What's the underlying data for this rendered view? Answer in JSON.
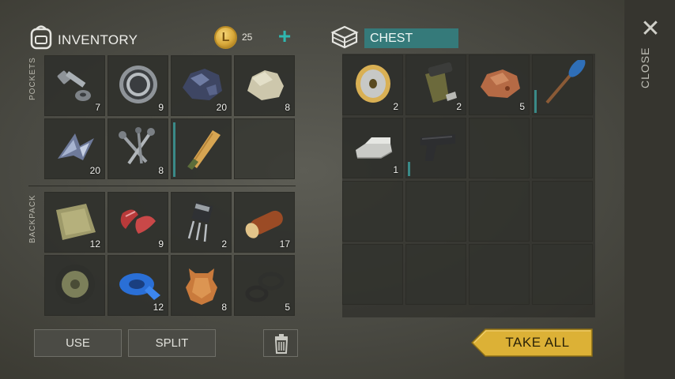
{
  "inventory": {
    "title": "INVENTORY",
    "coins": "25"
  },
  "chest": {
    "title": "CHEST"
  },
  "close": {
    "label": "CLOSE"
  },
  "sections": {
    "pockets": "POCKETS",
    "backpack": "BACKPACK"
  },
  "pockets": [
    {
      "name": "bolt-nut-item",
      "icon": "bolt-and-nut",
      "count": "7"
    },
    {
      "name": "bearing-item",
      "icon": "ball-bearing",
      "count": "9"
    },
    {
      "name": "ore-item",
      "icon": "iron-ore",
      "count": "20"
    },
    {
      "name": "stone-item",
      "icon": "stone",
      "count": "8"
    },
    {
      "name": "scrap-metal-item",
      "icon": "scrap-metal",
      "count": "20"
    },
    {
      "name": "nails-item",
      "icon": "nails",
      "count": "8"
    },
    {
      "name": "wooden-club-item",
      "icon": "wooden-club",
      "count": "",
      "durability": 0.95
    },
    {
      "name": "empty-slot",
      "icon": "",
      "count": ""
    }
  ],
  "backpack": [
    {
      "name": "cloth-item",
      "icon": "cloth",
      "count": "12"
    },
    {
      "name": "raw-meat-item",
      "icon": "raw-meat",
      "count": "9"
    },
    {
      "name": "transistor-item",
      "icon": "transistor",
      "count": "2"
    },
    {
      "name": "log-item",
      "icon": "log",
      "count": "17"
    },
    {
      "name": "wheel-item",
      "icon": "wheel",
      "count": ""
    },
    {
      "name": "tape-item",
      "icon": "duct-tape",
      "count": "12"
    },
    {
      "name": "leather-item",
      "icon": "leather-hide",
      "count": "8"
    },
    {
      "name": "rubber-rings-item",
      "icon": "rubber-rings",
      "count": "5"
    }
  ],
  "chest_items": [
    {
      "name": "wire-spool-item",
      "icon": "wire-spool",
      "count": "2"
    },
    {
      "name": "ammo-magazine-item",
      "icon": "magazine",
      "count": "2"
    },
    {
      "name": "copper-ore-item",
      "icon": "copper-ore",
      "count": "5"
    },
    {
      "name": "paddle-item",
      "icon": "paddle",
      "count": "",
      "durability": 0.4
    },
    {
      "name": "metal-ingots-item",
      "icon": "ingots",
      "count": "1"
    },
    {
      "name": "pistol-item",
      "icon": "pistol",
      "count": "",
      "durability": 0.25
    }
  ],
  "actions": {
    "use": "USE",
    "split": "SPLIT",
    "take_all": "TAKE ALL"
  },
  "colors": {
    "accent": "#357a7a",
    "take_all": "#e0b53a",
    "coin": "#d9a93a"
  }
}
